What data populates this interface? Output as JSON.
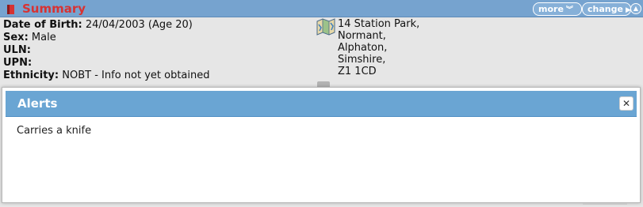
{
  "summary": {
    "title": "Summary",
    "more_label": "more",
    "change_label": "change",
    "fields": {
      "dob_label": "Date of Birth:",
      "dob_value": "24/04/2003 (Age 20)",
      "sex_label": "Sex:",
      "sex_value": "Male",
      "uln_label": "ULN:",
      "uln_value": "",
      "upn_label": "UPN:",
      "upn_value": "",
      "ethnicity_label": "Ethnicity:",
      "ethnicity_value": "NOBT - Info not yet obtained"
    },
    "address": [
      "14 Station Park,",
      "Normant,",
      "Alphaton,",
      "Simshire,",
      "Z1 1CD"
    ]
  },
  "alerts": {
    "title": "Alerts",
    "message": "Carries a knife"
  },
  "colors": {
    "header_bg": "#76a3cf",
    "summary_title": "#d83232",
    "dialog_titlebar": "#6aa5d3"
  }
}
